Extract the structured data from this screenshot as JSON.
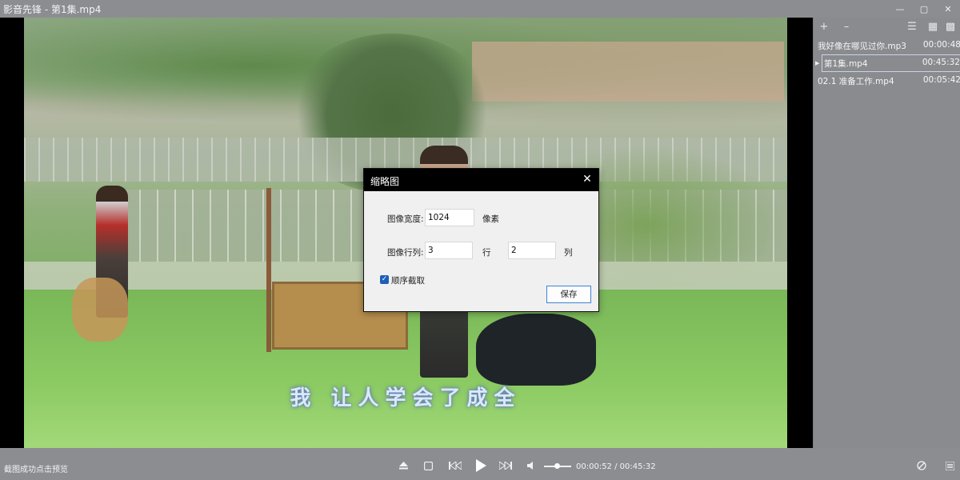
{
  "window": {
    "title": "影音先锋 - 第1集.mp4",
    "controls": [
      "minimize-icon",
      "maximize-icon",
      "close-icon"
    ]
  },
  "video": {
    "subtitle": "我 让人学会了成全"
  },
  "playlist": {
    "toolbar_icons": [
      "add-icon",
      "remove-icon",
      "list-icon",
      "playlist-icon",
      "grid-icon"
    ],
    "items": [
      {
        "name": "我好像在哪见过你.mp3",
        "duration": "00:00:48",
        "active": false
      },
      {
        "name": "第1集.mp4",
        "duration": "00:45:32",
        "active": true
      },
      {
        "name": "02.1 准备工作.mp4",
        "duration": "00:05:42",
        "active": false
      }
    ]
  },
  "bottom": {
    "status": "截图成功点击预览",
    "current_time": "00:00:52",
    "separator": " / ",
    "total_time": "00:45:32",
    "volume_level": 0.45
  },
  "dialog": {
    "title": "缩略图",
    "width_label": "图像宽度:",
    "width_value": "1024",
    "width_unit": "像素",
    "grid_label": "图像行列:",
    "rows_value": "3",
    "rows_unit": "行",
    "cols_value": "2",
    "cols_unit": "列",
    "sequential_label": "顺序截取",
    "sequential_checked": true,
    "save_label": "保存"
  },
  "colors": {
    "chrome": "#8c8d91",
    "dialog_title_bg": "#000000",
    "checkbox": "#1d5fb8",
    "button_border": "#3b84d6"
  }
}
